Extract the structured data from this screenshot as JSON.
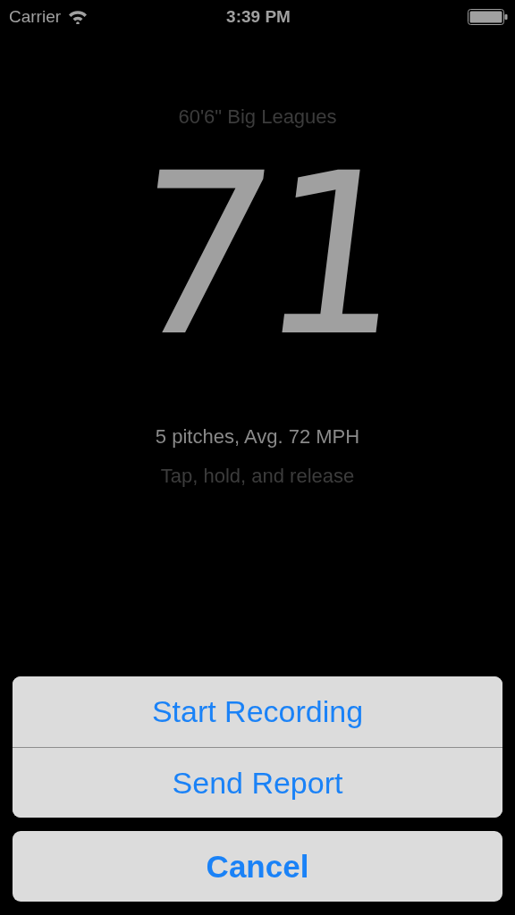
{
  "status_bar": {
    "carrier": "Carrier",
    "time": "3:39 PM"
  },
  "distance_label": "60'6\" Big Leagues",
  "speed_display": {
    "reading": "71"
  },
  "stats": "5 pitches, Avg. 72 MPH",
  "hint": "Tap, hold, and release",
  "action_sheet": {
    "actions": [
      {
        "label": "Start Recording"
      },
      {
        "label": "Send Report"
      }
    ],
    "cancel": {
      "label": "Cancel",
      "kind": "cancel"
    }
  }
}
